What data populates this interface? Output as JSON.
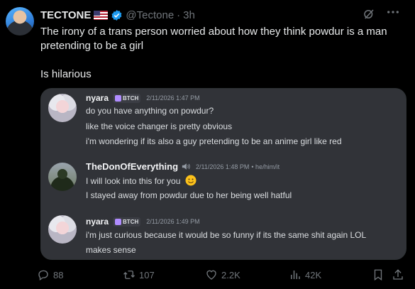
{
  "tweet": {
    "author_name": "TECTONE",
    "handle": "@Tectone",
    "separator": "·",
    "time": "3h",
    "text_line1": "The irony of a trans person worried about how they think powdur is a man pretending to be a girl",
    "text_line2": "Is hilarious"
  },
  "card": {
    "messages": [
      {
        "user": "nyara",
        "tag": "BTCH",
        "time": "2/11/2026 1:47 PM",
        "lines": [
          "do you have anything on powdur?",
          "like the voice changer is pretty obvious",
          "i'm wondering if its also a guy pretending to be an anime girl like red"
        ]
      },
      {
        "user": "TheDonOfEverything",
        "time": "2/11/2026 1:48 PM",
        "pronouns": "• he/him/it",
        "lines": [
          "I will look into this for you",
          "I stayed away from powdur due to her being well hatful"
        ]
      },
      {
        "user": "nyara",
        "tag": "BTCH",
        "time": "2/11/2026 1:49 PM",
        "lines": [
          "i'm just curious because it would be so funny if its the same shit again LOL",
          "makes sense"
        ]
      }
    ]
  },
  "actions": {
    "replies": "88",
    "reposts": "107",
    "likes": "2.2K",
    "views": "42K"
  },
  "colors": {
    "background": "#000000",
    "card_background": "#313338",
    "verified_blue": "#1d9bf0",
    "muted_text": "#71767b"
  },
  "icons": [
    "verified-badge-icon",
    "grok-icon",
    "more-icon",
    "reply-icon",
    "repost-icon",
    "like-icon",
    "views-icon",
    "bookmark-icon",
    "share-icon",
    "speaker-icon",
    "smile-emoji-icon",
    "server-tag-icon"
  ]
}
